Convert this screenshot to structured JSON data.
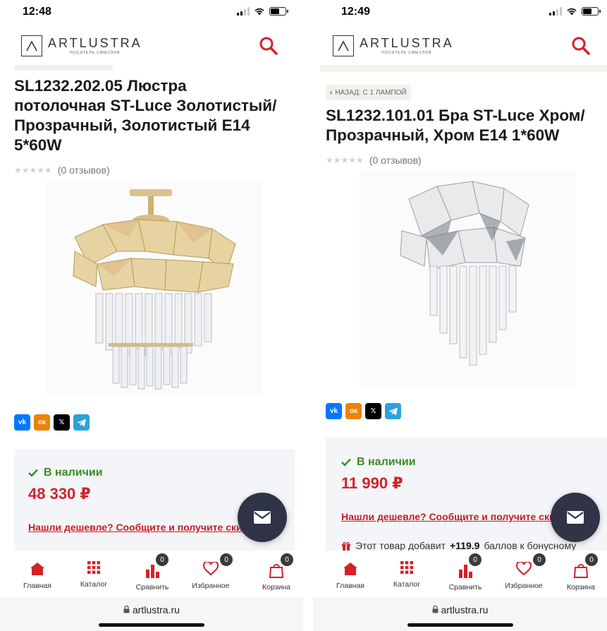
{
  "brand": {
    "name": "ARTLUSTRA",
    "tagline": "НОСИТЕЛЬ СМЫСЛОВ",
    "accent": "#d3222a",
    "stock_color": "#3d8a24"
  },
  "screens": [
    {
      "status": {
        "time": "12:48"
      },
      "product": {
        "title_lines": [
          "SL1232.202.05 Люстра",
          "потолочная ST-Luce Золотистый/",
          "Прозрачный, Золотистый E14",
          "5*60W"
        ],
        "reviews": "(0 отзывов)",
        "stock": "В наличии",
        "price": "48 330 ₽",
        "cheaper_link": "Нашли дешевле? Сообщите и получите скид"
      },
      "share": [
        "VK",
        "OK",
        "X",
        "Telegram"
      ],
      "tabs": [
        {
          "label": "Главная",
          "icon": "home-icon"
        },
        {
          "label": "Каталог",
          "icon": "grid-icon"
        },
        {
          "label": "Сравнить",
          "icon": "compare-icon",
          "badge": "0"
        },
        {
          "label": "Избранное",
          "icon": "heart-icon",
          "badge": "0"
        },
        {
          "label": "Корзина",
          "icon": "bag-icon",
          "badge": "0"
        }
      ],
      "url": "artlustra.ru"
    },
    {
      "status": {
        "time": "12:49"
      },
      "back_link": "НАЗАД: С 1 ЛАМПОЙ",
      "product": {
        "title_lines": [
          "SL1232.101.01 Бра ST-Luce Хром/",
          "Прозрачный, Хром E14 1*60W"
        ],
        "reviews": "(0 отзывов)",
        "stock": "В наличии",
        "price": "11 990 ₽",
        "cheaper_link": "Нашли дешевле? Сообщите и получите скид",
        "bonus_prefix": "Этот товар добавит",
        "bonus_value": "+119.9",
        "bonus_suffix": "баллов к бонусному"
      },
      "share": [
        "VK",
        "OK",
        "X",
        "Telegram"
      ],
      "tabs": [
        {
          "label": "Главная",
          "icon": "home-icon"
        },
        {
          "label": "Каталог",
          "icon": "grid-icon"
        },
        {
          "label": "Сравнить",
          "icon": "compare-icon",
          "badge": "0"
        },
        {
          "label": "Избранное",
          "icon": "heart-icon",
          "badge": "0"
        },
        {
          "label": "Корзина",
          "icon": "bag-icon",
          "badge": "0"
        }
      ],
      "url": "artlustra.ru"
    }
  ]
}
